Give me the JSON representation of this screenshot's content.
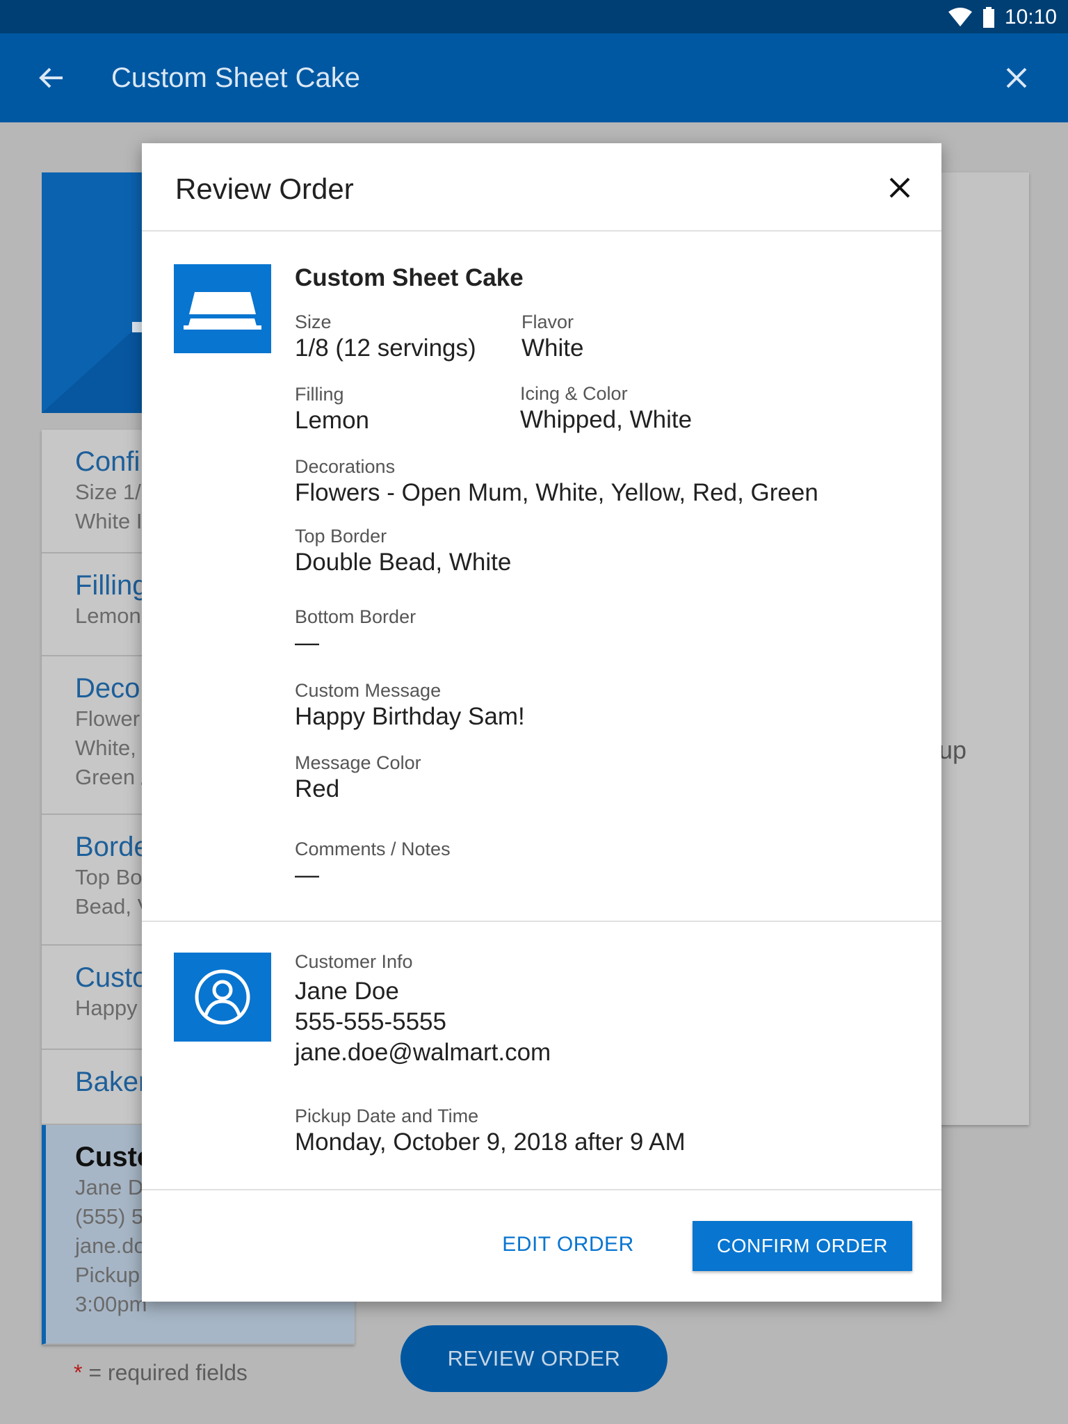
{
  "status_bar": {
    "time": "10:10"
  },
  "app_bar": {
    "title": "Custom Sheet Cake"
  },
  "background": {
    "list_items": [
      {
        "title": "Confi",
        "lines": [
          "Size 1/",
          "White I"
        ]
      },
      {
        "title": "Filling",
        "lines": [
          "Lemon"
        ]
      },
      {
        "title": "Deco",
        "lines": [
          "Flower",
          "White,",
          "Green /"
        ]
      },
      {
        "title": "Borde",
        "lines": [
          "Top Bo",
          "Bead, V"
        ]
      },
      {
        "title": "Custo",
        "lines": [
          "Happy"
        ]
      },
      {
        "title": "Baker",
        "lines": []
      },
      {
        "title": "Custo",
        "lines": [
          "Jane D",
          "(555) 5",
          "jane.do",
          "Pickup",
          "3:00pm"
        ]
      }
    ],
    "right_card_text": "up",
    "required_note_star": "*",
    "required_note": " = required fields",
    "review_button": "REVIEW ORDER"
  },
  "dialog": {
    "title": "Review Order",
    "product": {
      "name": "Custom Sheet Cake",
      "size": {
        "label": "Size",
        "value": "1/8 (12 servings)"
      },
      "flavor": {
        "label": "Flavor",
        "value": "White"
      },
      "filling": {
        "label": "Filling",
        "value": "Lemon"
      },
      "icing": {
        "label": "Icing & Color",
        "value": "Whipped, White"
      },
      "decorations": {
        "label": "Decorations",
        "value": "Flowers - Open Mum, White, Yellow, Red, Green"
      },
      "top_border": {
        "label": "Top Border",
        "value": "Double Bead, White"
      },
      "bottom_border": {
        "label": "Bottom Border",
        "value": "—"
      },
      "custom_message": {
        "label": "Custom Message",
        "value": "Happy Birthday Sam!"
      },
      "message_color": {
        "label": "Message Color",
        "value": "Red"
      },
      "comments": {
        "label": "Comments / Notes",
        "value": "—"
      }
    },
    "customer": {
      "label": "Customer Info",
      "name": "Jane Doe",
      "phone": "555-555-5555",
      "email": "jane.doe@walmart.com",
      "pickup_label": "Pickup Date and Time",
      "pickup_value": "Monday, October 9, 2018 after 9 AM"
    },
    "actions": {
      "edit": "EDIT ORDER",
      "confirm": "CONFIRM ORDER"
    }
  },
  "colors": {
    "primary": "#0058a3",
    "accent": "#0875d0",
    "status_bar": "#003f73"
  },
  "icons": [
    "wifi-icon",
    "battery-icon",
    "back-arrow-icon",
    "close-icon",
    "cake-icon",
    "person-icon"
  ]
}
